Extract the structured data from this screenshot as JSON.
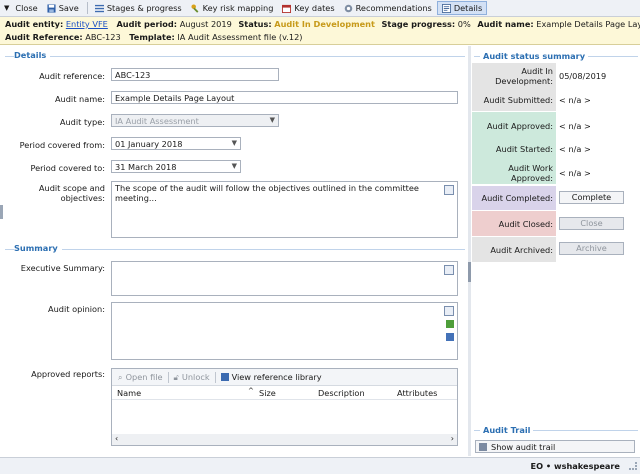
{
  "toolbar": {
    "close": "Close",
    "save": "Save",
    "stages": "Stages & progress",
    "key_risk": "Key risk mapping",
    "key_dates": "Key dates",
    "recommendations": "Recommendations",
    "details": "Details"
  },
  "info": {
    "entity_label": "Audit entity:",
    "entity_value": "Entity VFE",
    "period_label": "Audit period:",
    "period_value": "August 2019",
    "status_label": "Status:",
    "status_value": "Audit In Development",
    "progress_label": "Stage progress:",
    "progress_value": "0%",
    "name_label": "Audit name:",
    "name_value": "Example Details Page Layout",
    "ref_label": "Audit Reference:",
    "ref_value": "ABC-123",
    "template_label": "Template:",
    "template_value": "IA Audit Assessment file (v.12)"
  },
  "details": {
    "heading": "Details",
    "ref_label": "Audit reference:",
    "ref_value": "ABC-123",
    "name_label": "Audit name:",
    "name_value": "Example Details Page Layout",
    "type_label": "Audit type:",
    "type_value": "IA Audit Assessment",
    "from_label": "Period covered from:",
    "from_value": "01 January 2018",
    "to_label": "Period covered to:",
    "to_value": "31 March 2018",
    "scope_label": "Audit scope and objectives:",
    "scope_value": "The scope of the audit will follow the objectives outlined in the committee meeting..."
  },
  "summary": {
    "heading": "Summary",
    "exec_label": "Executive Summary:",
    "exec_value": "",
    "opinion_label": "Audit opinion:",
    "opinion_value": "",
    "reports_label": "Approved reports:",
    "open_file": "Open file",
    "unlock": "Unlock",
    "view_library": "View reference library",
    "columns": [
      "Name",
      "Size",
      "Description",
      "Attributes"
    ]
  },
  "status_summary": {
    "heading": "Audit status summary",
    "stages": [
      {
        "label": "Audit In Development:",
        "value": "05/08/2019"
      },
      {
        "label": "Audit Submitted:",
        "value": "< n/a >"
      },
      {
        "label": "Audit Approved:",
        "value": "< n/a >"
      },
      {
        "label": "Audit Started:",
        "value": "< n/a >"
      },
      {
        "label": "Audit Work Approved:",
        "value": "< n/a >"
      },
      {
        "label": "Audit Completed:",
        "value": "Complete"
      },
      {
        "label": "Audit Closed:",
        "value": "Close"
      },
      {
        "label": "Audit Archived:",
        "value": "Archive"
      }
    ],
    "colors": {
      "development": "#e4e4e4",
      "submitted": "#e4e4e4",
      "approved": "#cde9dc",
      "completed": "#d9d3ea",
      "closed": "#eecece",
      "archived": "#e4e4e4"
    }
  },
  "trail": {
    "heading": "Audit Trail",
    "show": "Show audit trail"
  },
  "statusbar": {
    "user": "EO • wshakespeare"
  }
}
